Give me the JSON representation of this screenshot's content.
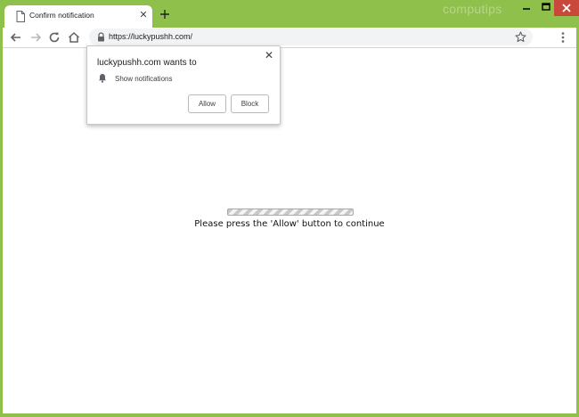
{
  "tab": {
    "title": "Confirm notification",
    "close_glyph": "✕",
    "icon": "document-icon"
  },
  "newtab": {
    "icon": "plus-icon"
  },
  "watermark": "computips",
  "window_controls": {
    "minimize": "minimize-icon",
    "maximize": "maximize-icon",
    "close": "close-icon",
    "close_color": "#c9483b"
  },
  "toolbar": {
    "back_icon": "back-arrow-icon",
    "forward_icon": "forward-arrow-icon",
    "reload_icon": "reload-icon",
    "home_icon": "home-icon",
    "url": "https://luckypushh.com/",
    "star_icon": "star-icon",
    "menu_icon": "kebab-menu-icon"
  },
  "popup": {
    "title": "luckypushh.com wants to",
    "close_glyph": "✕",
    "permission": "Show notifications",
    "allow_label": "Allow",
    "block_label": "Block"
  },
  "page": {
    "message": "Please press the 'Allow' button to continue"
  },
  "colors": {
    "frame": "#8fc04c",
    "content_bg": "#ffffff"
  }
}
